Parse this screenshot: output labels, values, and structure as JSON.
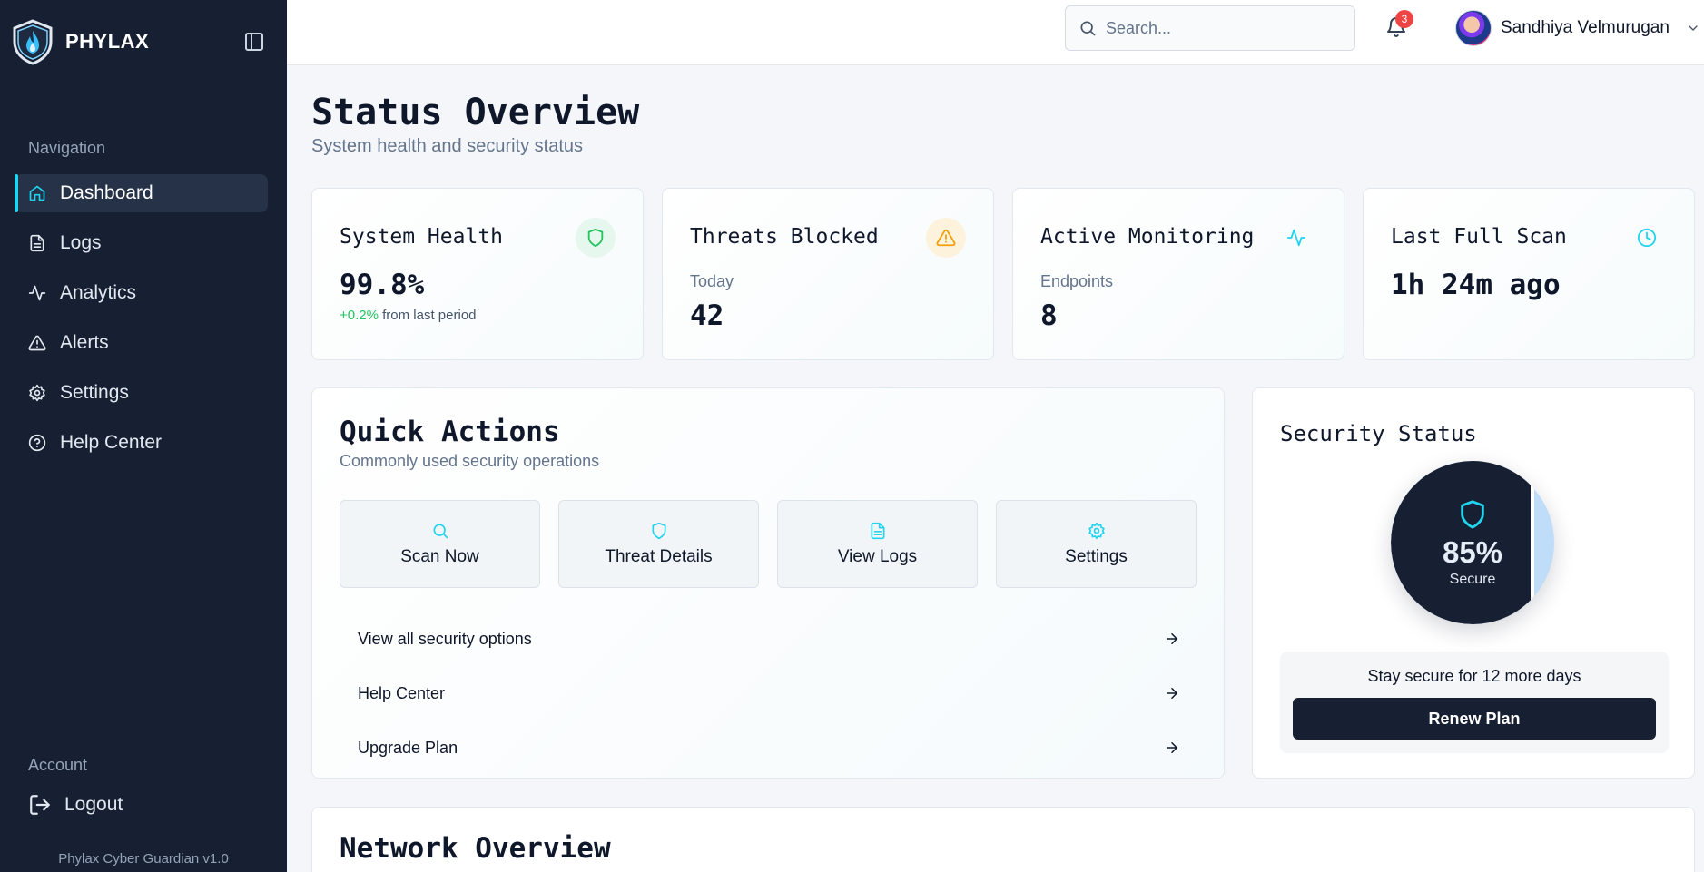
{
  "brand": {
    "name": "PHYLAX"
  },
  "sidebar": {
    "nav_heading": "Navigation",
    "items": [
      {
        "label": "Dashboard",
        "icon": "home-icon",
        "active": true
      },
      {
        "label": "Logs",
        "icon": "file-text-icon"
      },
      {
        "label": "Analytics",
        "icon": "activity-icon"
      },
      {
        "label": "Alerts",
        "icon": "alert-triangle-icon"
      },
      {
        "label": "Settings",
        "icon": "gear-icon"
      },
      {
        "label": "Help Center",
        "icon": "help-circle-icon"
      }
    ],
    "account_heading": "Account",
    "logout_label": "Logout",
    "version": "Phylax Cyber Guardian v1.0"
  },
  "header": {
    "search_placeholder": "Search...",
    "notifications_count": "3",
    "user_name": "Sandhiya Velmurugan"
  },
  "page": {
    "title": "Status Overview",
    "subtitle": "System health and security status"
  },
  "stats": [
    {
      "title": "System Health",
      "value": "99.8%",
      "change": "+0.2%",
      "change_suffix": "from last period",
      "icon": "shield-icon",
      "color": "#22c55e"
    },
    {
      "title": "Threats Blocked",
      "subtitle": "Today",
      "value": "42",
      "icon": "alert-triangle-icon",
      "color": "#f59e0b"
    },
    {
      "title": "Active Monitoring",
      "subtitle": "Endpoints",
      "value": "8",
      "icon": "activity-icon",
      "color": "#22d3ee"
    },
    {
      "title": "Last Full Scan",
      "value": "1h 24m ago",
      "icon": "clock-icon",
      "color": "#22d3ee"
    }
  ],
  "quick_actions": {
    "title": "Quick Actions",
    "subtitle": "Commonly used security operations",
    "buttons": [
      {
        "label": "Scan Now",
        "icon": "search-icon"
      },
      {
        "label": "Threat Details",
        "icon": "shield-icon"
      },
      {
        "label": "View Logs",
        "icon": "file-text-icon"
      },
      {
        "label": "Settings",
        "icon": "gear-icon"
      }
    ],
    "links": [
      {
        "label": "View all security options"
      },
      {
        "label": "Help Center"
      },
      {
        "label": "Upgrade Plan"
      }
    ]
  },
  "security_status": {
    "title": "Security Status",
    "percent": "85%",
    "percent_value": 0.85,
    "label": "Secure",
    "renew_text": "Stay secure for 12 more days",
    "renew_button": "Renew Plan"
  },
  "network": {
    "title": "Network Overview"
  },
  "colors": {
    "accent": "#22d3ee",
    "sidebar_bg": "#172033",
    "success": "#22c55e",
    "warning": "#f59e0b",
    "danger": "#ef4444"
  }
}
